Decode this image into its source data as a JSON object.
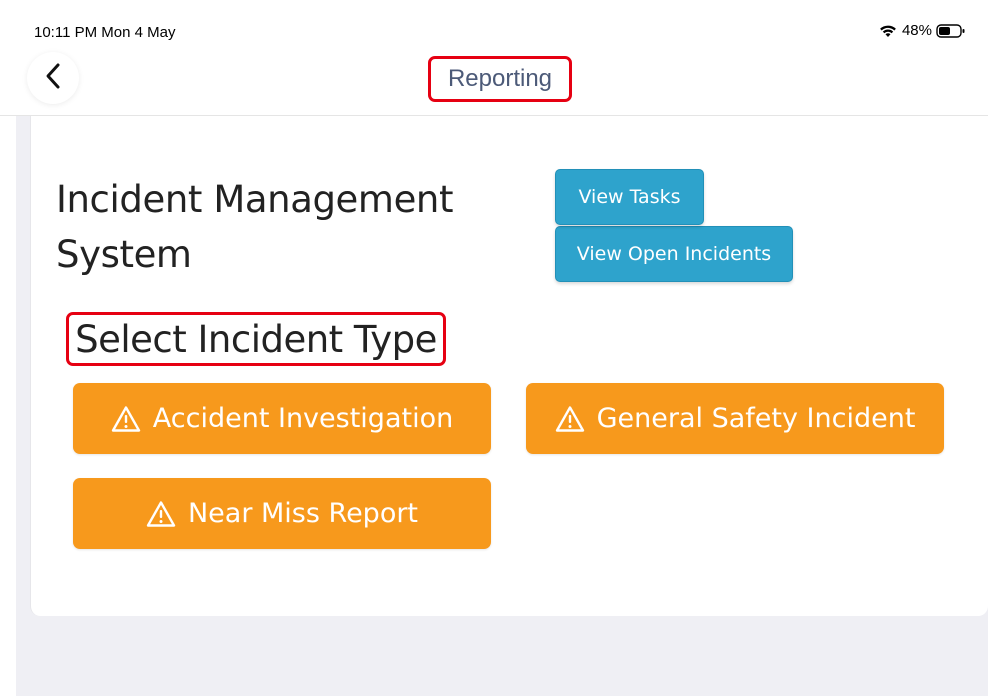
{
  "status_bar": {
    "time_date": "10:11 PM  Mon 4 May",
    "battery": "48%"
  },
  "nav": {
    "title": "Reporting",
    "back_icon": "chevron-left-icon"
  },
  "main": {
    "app_title": "Incident Management System",
    "view_tasks_label": "View Tasks",
    "view_open_incidents_label": "View Open Incidents",
    "section_title": "Select Incident Type",
    "incident_types": [
      {
        "label": "Accident Investigation",
        "icon": "warning-icon"
      },
      {
        "label": "General Safety Incident",
        "icon": "warning-icon"
      },
      {
        "label": "Near Miss Report",
        "icon": "warning-icon"
      }
    ]
  },
  "colors": {
    "primary_blue": "#2ea3cc",
    "incident_orange": "#f7991c",
    "highlight_red": "#e60012",
    "title_text": "#4c5a78",
    "background": "#efeff4"
  }
}
